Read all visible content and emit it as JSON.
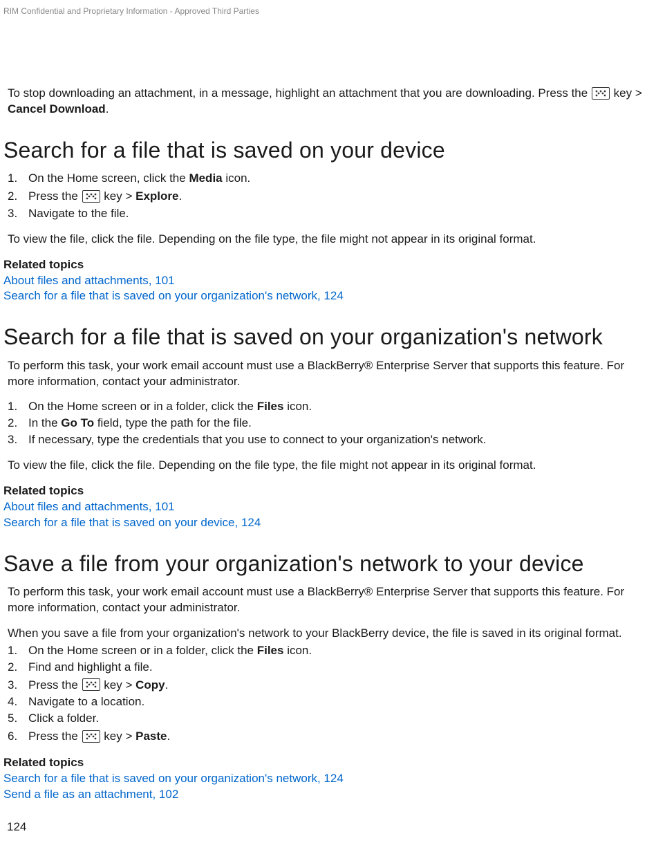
{
  "header": {
    "confidential": "RIM Confidential and Proprietary Information - Approved Third Parties"
  },
  "intro": {
    "prefix": "To stop downloading an attachment, in a message, highlight an attachment that you are downloading. Press the ",
    "suffix_key_gt": " key > ",
    "cancel_download": "Cancel Download",
    "period": "."
  },
  "section1": {
    "title": "Search for a file that is saved on your device",
    "steps": {
      "s1_pre": "On the Home screen, click the ",
      "s1_bold": "Media",
      "s1_post": " icon.",
      "s2_pre": "Press the ",
      "s2_mid": " key > ",
      "s2_bold": "Explore",
      "s2_post": ".",
      "s3": "Navigate to the file."
    },
    "after": "To view the file, click the file. Depending on the file type, the file might not appear in its original format.",
    "related_label": "Related topics",
    "link1": "About files and attachments, 101",
    "link2": "Search for a file that is saved on your organization's network, 124"
  },
  "section2": {
    "title": "Search for a file that is saved on your organization's network",
    "prereq": "To perform this task, your work email account must use a BlackBerry® Enterprise Server that supports this feature. For more information, contact your administrator.",
    "steps": {
      "s1_pre": "On the Home screen or in a folder, click the ",
      "s1_bold": "Files",
      "s1_post": " icon.",
      "s2_pre": "In the ",
      "s2_bold": "Go To",
      "s2_post": " field, type the path for the file.",
      "s3": "If necessary, type the credentials that you use to connect to your organization's network."
    },
    "after": "To view the file, click the file. Depending on the file type, the file might not appear in its original format.",
    "related_label": "Related topics",
    "link1": "About files and attachments, 101",
    "link2": "Search for a file that is saved on your device, 124"
  },
  "section3": {
    "title": "Save a file from your organization's network to your device",
    "prereq": "To perform this task, your work email account must use a BlackBerry® Enterprise Server that supports this feature. For more information, contact your administrator.",
    "note": "When you save a file from your organization's network to your BlackBerry device, the file is saved in its original format.",
    "steps": {
      "s1_pre": "On the Home screen or in a folder, click the ",
      "s1_bold": "Files",
      "s1_post": " icon.",
      "s2": "Find and highlight a file.",
      "s3_pre": "Press the ",
      "s3_mid": " key > ",
      "s3_bold": "Copy",
      "s3_post": ".",
      "s4": "Navigate to a location.",
      "s5": "Click a folder.",
      "s6_pre": "Press the ",
      "s6_mid": " key > ",
      "s6_bold": "Paste",
      "s6_post": "."
    },
    "related_label": "Related topics",
    "link1": "Search for a file that is saved on your organization's network, 124",
    "link2": "Send a file as an attachment, 102"
  },
  "page_number": "124"
}
